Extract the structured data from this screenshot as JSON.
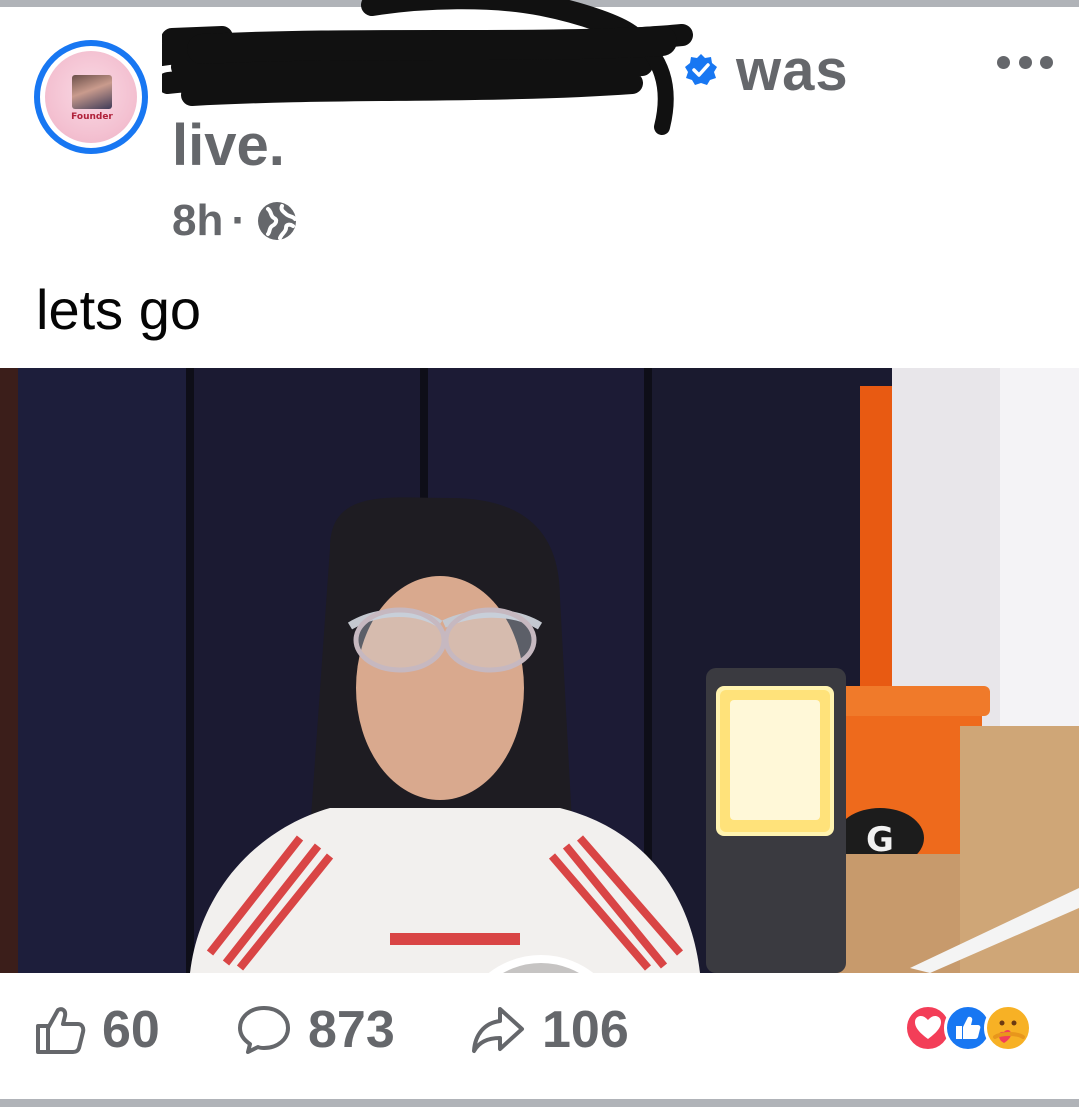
{
  "post": {
    "status_suffix": "was",
    "status_line2": "live.",
    "time": "8h",
    "separator": "·",
    "caption": "lets go",
    "avatar_badge_text": "Founder"
  },
  "icons": {
    "verified": "verified-badge-icon",
    "privacy": "globe-icon",
    "more": "more-options-icon",
    "play": "play-icon",
    "like": "like-icon",
    "comment": "comment-icon",
    "share": "share-icon"
  },
  "stats": {
    "likes": "60",
    "comments": "873",
    "shares": "106"
  },
  "reactions": [
    "love",
    "like",
    "care"
  ],
  "colors": {
    "accent": "#1877f2",
    "secondary_text": "#65676b",
    "love": "#f33e58",
    "care": "#f7b125"
  }
}
